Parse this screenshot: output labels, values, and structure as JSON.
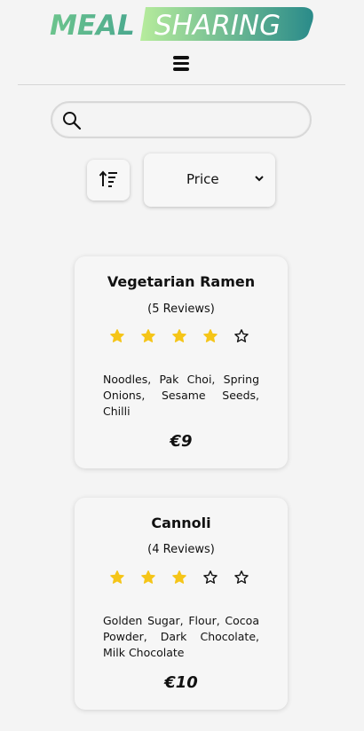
{
  "logo": {
    "word1": "MEAL",
    "word2": "SHARING"
  },
  "search": {
    "value": "",
    "placeholder": ""
  },
  "sort": {
    "icon": "sort-ascending-icon",
    "selected": "Price"
  },
  "colors": {
    "star_filled": "#F5C518",
    "logo_green": "#7ed99b",
    "logo_teal": "#2d8f8a"
  },
  "meals": [
    {
      "title": "Vegetarian Ramen",
      "reviews": "(5 Reviews)",
      "rating": 4,
      "ingredients": "Noodles, Pak Choi, Spring Onions, Sesame Seeds, Chilli",
      "price": "€9"
    },
    {
      "title": "Cannoli",
      "reviews": "(4 Reviews)",
      "rating": 3,
      "ingredients": "Golden Sugar, Flour, Cocoa Powder, Dark Chocolate, Milk Chocolate",
      "price": "€10"
    }
  ]
}
